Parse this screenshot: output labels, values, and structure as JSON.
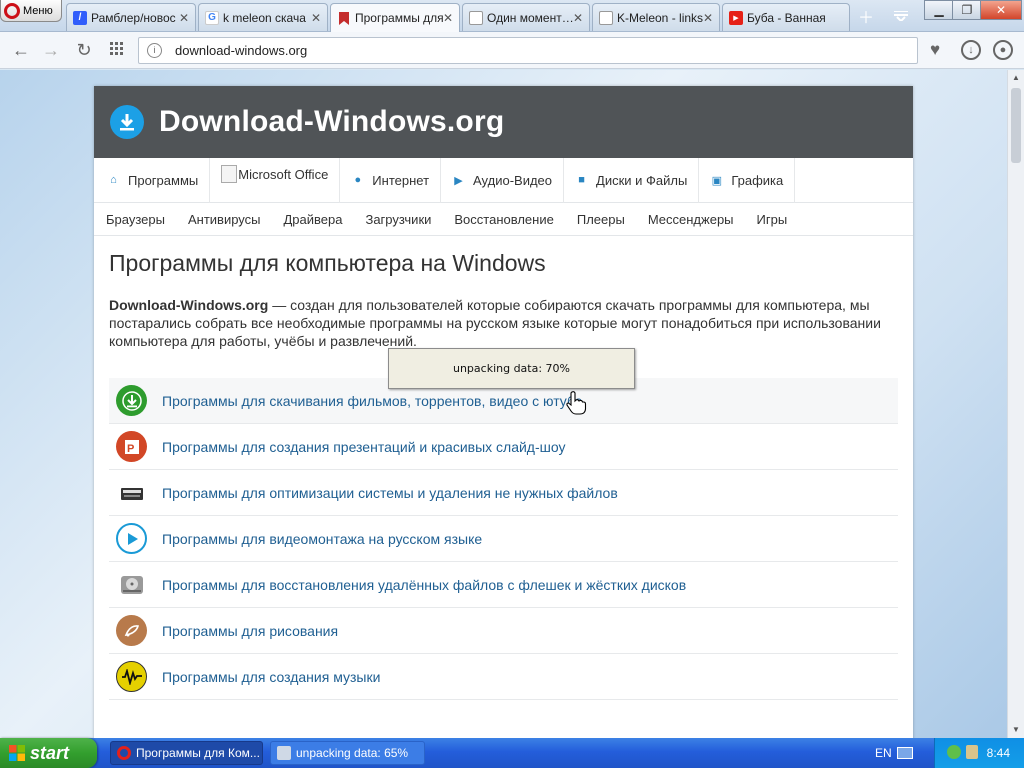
{
  "browser": {
    "menu_label": "Меню",
    "tabs": [
      {
        "title": "Рамблер/новос",
        "icon": "rambler-icon",
        "fav_color": "#315efb",
        "fav_char": "/"
      },
      {
        "title": "k meleon скача",
        "icon": "google-icon",
        "fav_color": "#ffffff",
        "fav_char": "G"
      },
      {
        "title": "Программы для",
        "icon": "bookmark-icon",
        "fav_color": "#c42d2d",
        "fav_char": ""
      },
      {
        "title": "Один момент…",
        "icon": "page-icon",
        "fav_color": "#ffffff",
        "fav_char": ""
      },
      {
        "title": "K-Meleon - links",
        "icon": "page-icon",
        "fav_color": "#ffffff",
        "fav_char": ""
      },
      {
        "title": "Буба - Ванная",
        "icon": "youtube-icon",
        "fav_color": "#e62117",
        "fav_char": "▶"
      }
    ],
    "active_tab": 2,
    "url": "download-windows.org"
  },
  "site": {
    "logo_text": "Download-Windows.org",
    "main_nav": [
      {
        "label": "Программы",
        "icon": "home-icon"
      },
      {
        "label": "Microsoft Office",
        "icon": "broken-image-icon"
      },
      {
        "label": "Интернет",
        "icon": "globe-icon"
      },
      {
        "label": "Аудио-Видео",
        "icon": "play-icon"
      },
      {
        "label": "Диски и Файлы",
        "icon": "archive-icon"
      },
      {
        "label": "Графика",
        "icon": "image-icon"
      }
    ],
    "sub_nav": [
      "Браузеры",
      "Антивирусы",
      "Драйвера",
      "Загрузчики",
      "Восстановление",
      "Плееры",
      "Мессенджеры",
      "Игры"
    ],
    "page_title": "Программы для компьютера на Windows",
    "intro_bold": "Download-Windows.org",
    "intro_rest": " — создан для пользователей которые собираются скачать программы для компьютера, мы постарались собрать все необходимые программы на русском языке которые могут понадобиться при использовании компьютера для работы, учёбы и развлечений.",
    "categories": [
      {
        "label": "Программы для скачивания фильмов, торрентов, видео с ютуба",
        "icon": "download-icon",
        "color": "#2e9c2e"
      },
      {
        "label": "Программы для создания презентаций и красивых слайд-шоу",
        "icon": "powerpoint-icon",
        "color": "#d24726"
      },
      {
        "label": "Программы для оптимизации системы и удаления не нужных файлов",
        "icon": "disk-cleanup-icon",
        "color": "#444444"
      },
      {
        "label": "Программы для видеомонтажа на русском языке",
        "icon": "play-circle-icon",
        "color": "#1a9ad6"
      },
      {
        "label": "Программы для восстановления удалённых файлов с флешек и жёстких дисков",
        "icon": "hard-drive-icon",
        "color": "#8a8a8a"
      },
      {
        "label": "Программы для рисования",
        "icon": "paint-icon",
        "color": "#b87a4b"
      },
      {
        "label": "Программы для создания музыки",
        "icon": "music-wave-icon",
        "color": "#e5d000"
      }
    ]
  },
  "popup": {
    "text": "unpacking data: 70%",
    "progress": 0.7
  },
  "taskbar": {
    "start_label": "start",
    "tasks": [
      {
        "label": "Программы для Ком...",
        "icon": "opera-icon"
      },
      {
        "label": "unpacking data: 65%",
        "icon": "installer-icon"
      }
    ],
    "language": "EN",
    "clock": "8:44"
  }
}
